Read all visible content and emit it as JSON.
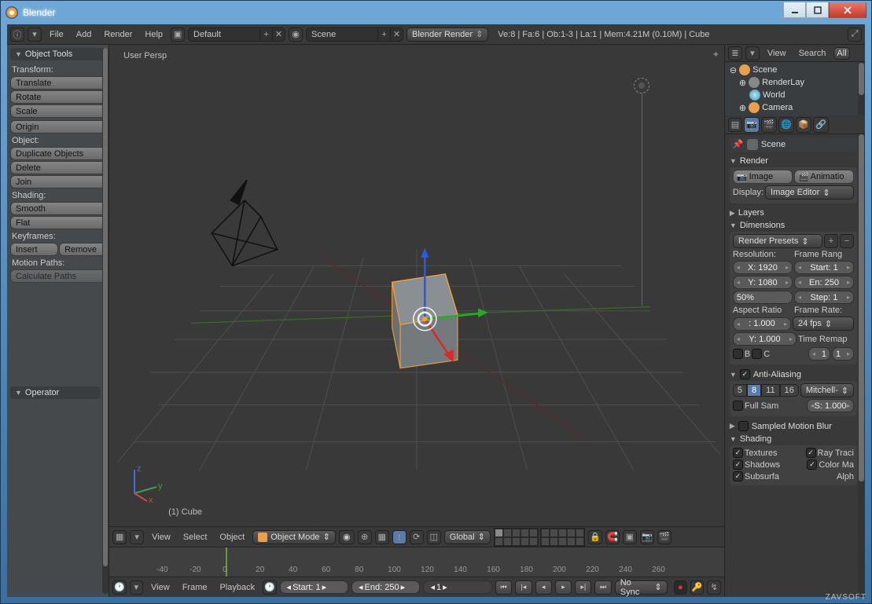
{
  "window": {
    "title": "Blender"
  },
  "topbar": {
    "menus": [
      "File",
      "Add",
      "Render",
      "Help"
    ],
    "layout": "Default",
    "scene": "Scene",
    "engine": "Blender Render",
    "stats": "Ve:8 | Fa:6 | Ob:1-3 | La:1 | Mem:4.21M (0.10M) | Cube"
  },
  "toolshelf": {
    "title": "Object Tools",
    "transform_label": "Transform:",
    "translate": "Translate",
    "rotate": "Rotate",
    "scale": "Scale",
    "origin": "Origin",
    "object_label": "Object:",
    "duplicate": "Duplicate Objects",
    "delete": "Delete",
    "join": "Join",
    "shading_label": "Shading:",
    "smooth": "Smooth",
    "flat": "Flat",
    "keyframes_label": "Keyframes:",
    "insert": "Insert",
    "remove": "Remove",
    "motion_label": "Motion Paths:",
    "calc": "Calculate Paths",
    "operator": "Operator"
  },
  "view3d": {
    "persp": "User Persp",
    "object": "(1) Cube",
    "hdr_menus": [
      "View",
      "Select",
      "Object"
    ],
    "mode": "Object Mode",
    "orient": "Global"
  },
  "timeline": {
    "ticks": [
      "-40",
      "-20",
      "0",
      "20",
      "40",
      "60",
      "80",
      "100",
      "120",
      "140",
      "160",
      "180",
      "200",
      "220",
      "240",
      "260"
    ],
    "menus": [
      "View",
      "Frame",
      "Playback"
    ],
    "start_lbl": "Start:",
    "start": "1",
    "end_lbl": "End:",
    "end": "250",
    "cur": "1",
    "sync": "No Sync"
  },
  "outliner": {
    "menus": [
      "View",
      "Search"
    ],
    "filter": "All",
    "items": [
      "Scene",
      "RenderLay",
      "World",
      "Camera"
    ]
  },
  "props": {
    "crumb": "Scene",
    "render": {
      "title": "Render",
      "image": "Image",
      "anim": "Animatio",
      "display_lbl": "Display:",
      "display": "Image Editor"
    },
    "layers": {
      "title": "Layers"
    },
    "dim": {
      "title": "Dimensions",
      "preset": "Render Presets",
      "res_lbl": "Resolution:",
      "x": "X: 1920",
      "y": "Y: 1080",
      "pct": "50%",
      "fr_lbl": "Frame Rang",
      "start": "Start: 1",
      "end": "En: 250",
      "step": "Step: 1",
      "ar_lbl": "Aspect Ratio",
      "ax": ": 1.000",
      "ay": "Y: 1.000",
      "rate_lbl": "Frame Rate:",
      "rate": "24 fps",
      "remap": "Time Remap",
      "old": "1",
      "new": "1",
      "b": "B",
      "c": "C"
    },
    "aa": {
      "title": "Anti-Aliasing",
      "s5": "5",
      "s8": "8",
      "s11": "11",
      "s16": "16",
      "filter": "Mitchell-",
      "full": "Full Sam",
      "size": "S: 1.000"
    },
    "smb": {
      "title": "Sampled Motion Blur"
    },
    "shading": {
      "title": "Shading",
      "tex": "Textures",
      "ray": "Ray Traci",
      "sh": "Shadows",
      "col": "Color Ma",
      "sub": "Subsurfa",
      "alpha": "Alph"
    }
  },
  "watermark": "ZAVSOFT"
}
